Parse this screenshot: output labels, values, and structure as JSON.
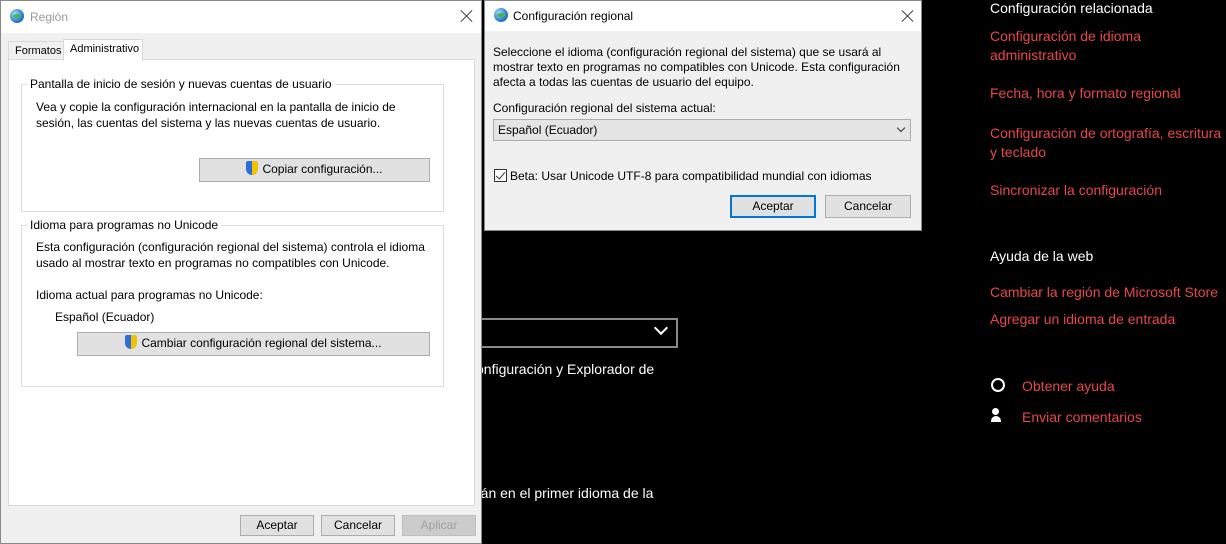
{
  "settings": {
    "related_heading": "Configuración relacionada",
    "related_links": [
      "Configuración de idioma",
      "administrativo",
      "Fecha, hora y formato regional",
      "Configuración de ortografía, escritura",
      "y teclado",
      "Sincronizar la configuración"
    ],
    "web_heading": "Ayuda de la web",
    "web_links": [
      "Cambiar la región de Microsoft Store",
      "Agregar un idioma de entrada"
    ],
    "help_link": "Obtener ayuda",
    "feedback_link": "Enviar comentarios",
    "bg_text_1": "onfiguración y Explorador de",
    "bg_text_2": "rán en el primer idioma de la",
    "link_color": "#e8474a"
  },
  "region_dialog": {
    "title": "Región",
    "tabs": [
      "Formatos",
      "Administrativo"
    ],
    "active_tab": "Administrativo",
    "welcome_group": {
      "title": "Pantalla de inicio de sesión y nuevas cuentas de usuario",
      "description_line1": "Vea y copie la configuración internacional en la pantalla de inicio de",
      "description_line2": "sesión, las cuentas del sistema y las nuevas cuentas de usuario.",
      "button": "Copiar configuración..."
    },
    "unicode_group": {
      "title": "Idioma para programas no Unicode",
      "description_line1": "Esta configuración (configuración regional del sistema) controla el idioma",
      "description_line2": "usado al mostrar texto en programas no compatibles con Unicode.",
      "current_label": "Idioma actual para programas no Unicode:",
      "current_value": "Español (Ecuador)",
      "button": "Cambiar configuración regional del sistema..."
    },
    "buttons": {
      "ok": "Aceptar",
      "cancel": "Cancelar",
      "apply": "Aplicar"
    }
  },
  "locale_dialog": {
    "title": "Configuración regional",
    "description_line1": "Seleccione el idioma (configuración regional del sistema) que se usará al",
    "description_line2": "mostrar texto en programas no compatibles con Unicode. Esta configuración",
    "description_line3": "afecta a todas las cuentas de usuario del equipo.",
    "current_label": "Configuración regional del sistema actual:",
    "selected_locale": "Español (Ecuador)",
    "beta_checkbox_label": "Beta: Usar Unicode UTF-8 para compatibilidad mundial con idiomas",
    "beta_checked": true,
    "ok": "Aceptar",
    "cancel": "Cancelar"
  }
}
